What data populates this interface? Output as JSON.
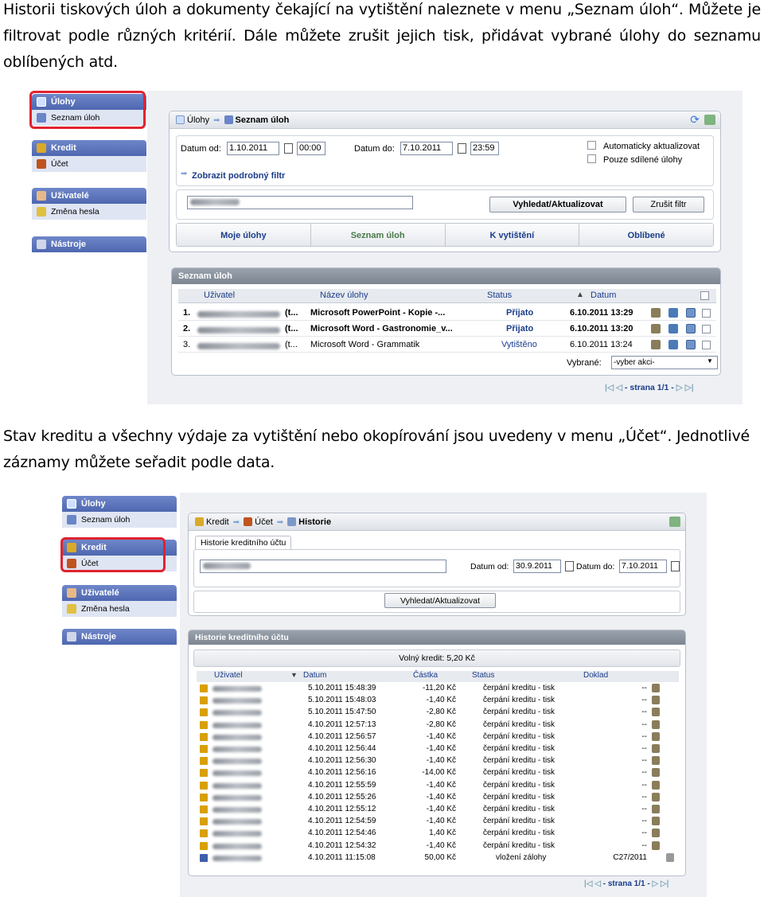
{
  "text": {
    "para1": "Historii tiskových úloh a dokumenty čekající na vytištění naleznete v menu „Seznam úloh“. Můžete je filtrovat podle různých kritérií. Dále můžete zrušit jejich tisk, přidávat vybrané úlohy do seznamu oblíbených atd.",
    "para2": "Stav kreditu a všechny výdaje za vytištění nebo okopírování jsou uvedeny v menu „Účet“. Jednotlivé záznamy můžete seřadit podle data."
  },
  "sidebar": {
    "ulohy": "Úlohy",
    "seznam": "Seznam úloh",
    "kredit": "Kredit",
    "ucet": "Účet",
    "uzivatele": "Uživatelé",
    "zmena_hesla": "Změna hesla",
    "nastroje": "Nástroje"
  },
  "shot1": {
    "crumb_ulohy": "Úlohy",
    "crumb_seznam": "Seznam úloh",
    "datum_od_label": "Datum od:",
    "datum_od": "1.10.2011",
    "cas_od": "00:00",
    "datum_do_label": "Datum do:",
    "datum_do": "7.10.2011",
    "cas_do": "23:59",
    "auto": "Automaticky aktualizovat",
    "sdilene": "Pouze sdílené úlohy",
    "filtr_link": "Zobrazit podrobný filtr",
    "search_btn": "Vyhledat/Aktualizovat",
    "reset_btn": "Zrušit filtr",
    "tabs": [
      "Moje úlohy",
      "Seznam úloh",
      "K vytištění",
      "Oblíbené"
    ],
    "list_title": "Seznam úloh",
    "cols": {
      "uzivatel": "Uživatel",
      "nazev": "Název úlohy",
      "status": "Status",
      "datum": "Datum"
    },
    "rows": [
      {
        "num": "1.",
        "user": "(t...",
        "name": "Microsoft PowerPoint - Kopie -...",
        "status": "Přijato",
        "date": "6.10.2011 13:29"
      },
      {
        "num": "2.",
        "user": "(t...",
        "name": "Microsoft Word - Gastronomie_v...",
        "status": "Přijato",
        "date": "6.10.2011 13:20"
      },
      {
        "num": "3.",
        "user": "(t...",
        "name": "Microsoft Word - Grammatik",
        "status": "Vytištěno",
        "date": "6.10.2011 13:24"
      }
    ],
    "vybrane_label": "Vybrané:",
    "vybrane_value": "-vyber akci-",
    "pager": "strana 1/1"
  },
  "shot2": {
    "crumb_kredit": "Kredit",
    "crumb_ucet": "Účet",
    "crumb_historie": "Historie",
    "tab": "Historie kreditního účtu",
    "datum_od_label": "Datum od:",
    "datum_od": "30.9.2011",
    "datum_do_label": "Datum do:",
    "datum_do": "7.10.2011",
    "search_btn": "Vyhledat/Aktualizovat",
    "list_title": "Historie kreditního účtu",
    "volny_kredit": "Volný kredit: 5,20 Kč",
    "cols": {
      "uzivatel": "Uživatel",
      "datum": "Datum",
      "castka": "Částka",
      "status": "Status",
      "doklad": "Doklad"
    },
    "rows": [
      {
        "date": "5.10.2011 15:48:39",
        "amount": "-11,20 Kč",
        "status": "čerpání kreditu - tisk",
        "doklad": "--"
      },
      {
        "date": "5.10.2011 15:48:03",
        "amount": "-1,40 Kč",
        "status": "čerpání kreditu - tisk",
        "doklad": "--"
      },
      {
        "date": "5.10.2011 15:47:50",
        "amount": "-2,80 Kč",
        "status": "čerpání kreditu - tisk",
        "doklad": "--"
      },
      {
        "date": "4.10.2011 12:57:13",
        "amount": "-2,80 Kč",
        "status": "čerpání kreditu - tisk",
        "doklad": "--"
      },
      {
        "date": "4.10.2011 12:56:57",
        "amount": "-1,40 Kč",
        "status": "čerpání kreditu - tisk",
        "doklad": "--"
      },
      {
        "date": "4.10.2011 12:56:44",
        "amount": "-1,40 Kč",
        "status": "čerpání kreditu - tisk",
        "doklad": "--"
      },
      {
        "date": "4.10.2011 12:56:30",
        "amount": "-1,40 Kč",
        "status": "čerpání kreditu - tisk",
        "doklad": "--"
      },
      {
        "date": "4.10.2011 12:56:16",
        "amount": "-14,00 Kč",
        "status": "čerpání kreditu - tisk",
        "doklad": "--"
      },
      {
        "date": "4.10.2011 12:55:59",
        "amount": "-1,40 Kč",
        "status": "čerpání kreditu - tisk",
        "doklad": "--"
      },
      {
        "date": "4.10.2011 12:55:26",
        "amount": "-1,40 Kč",
        "status": "čerpání kreditu - tisk",
        "doklad": "--"
      },
      {
        "date": "4.10.2011 12:55:12",
        "amount": "-1,40 Kč",
        "status": "čerpání kreditu - tisk",
        "doklad": "--"
      },
      {
        "date": "4.10.2011 12:54:59",
        "amount": "-1,40 Kč",
        "status": "čerpání kreditu - tisk",
        "doklad": "--"
      },
      {
        "date": "4.10.2011 12:54:46",
        "amount": "1,40 Kč",
        "status": "čerpání kreditu - tisk",
        "doklad": "--"
      },
      {
        "date": "4.10.2011 12:54:32",
        "amount": "-1,40 Kč",
        "status": "čerpání kreditu - tisk",
        "doklad": "--"
      },
      {
        "date": "4.10.2011 11:15:08",
        "amount": "50,00 Kč",
        "status": "vložení zálohy",
        "doklad": "C27/2011"
      }
    ],
    "pager": "strana 1/1"
  }
}
